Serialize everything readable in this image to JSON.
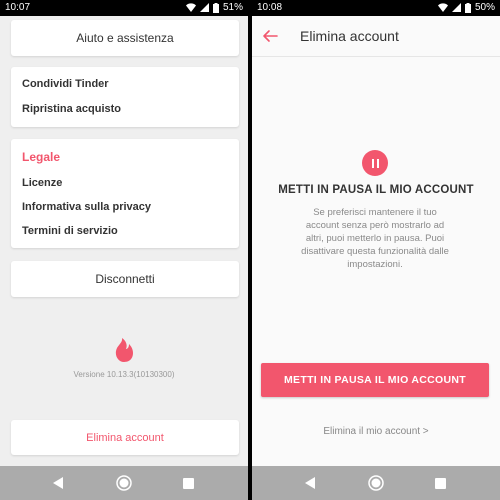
{
  "colors": {
    "accent": "#f2566d",
    "background": "#efefef",
    "card": "#ffffff",
    "navbar": "#ababab"
  },
  "left_screen": {
    "status": {
      "time": "10:07",
      "battery": "51%"
    },
    "help_card": {
      "label": "Aiuto e assistenza"
    },
    "share_card": {
      "items": [
        "Condividi Tinder",
        "Ripristina acquisto"
      ]
    },
    "legal_card": {
      "heading": "Legale",
      "items": [
        "Licenze",
        "Informativa sulla privacy",
        "Termini di servizio"
      ]
    },
    "logout_card": {
      "label": "Disconnetti"
    },
    "version": "Versione 10.13.3(10130300)",
    "delete_card": {
      "label": "Elimina account"
    }
  },
  "right_screen": {
    "status": {
      "time": "10:08",
      "battery": "50%"
    },
    "appbar": {
      "title": "Elimina account"
    },
    "pause": {
      "heading": "METTI IN PAUSA IL MIO ACCOUNT",
      "description": "Se preferisci mantenere il tuo account senza però mostrarlo ad altri, puoi metterlo in pausa. Puoi disattivare questa funzionalità dalle impostazioni.",
      "button_label": "METTI IN PAUSA IL MIO ACCOUNT"
    },
    "delete_link": "Elimina il mio account >"
  },
  "icons": [
    "wifi-icon",
    "signal-icon",
    "battery-icon",
    "back-arrow-icon",
    "pause-icon",
    "tinder-flame-icon",
    "nav-back-icon",
    "nav-home-icon",
    "nav-recents-icon"
  ]
}
